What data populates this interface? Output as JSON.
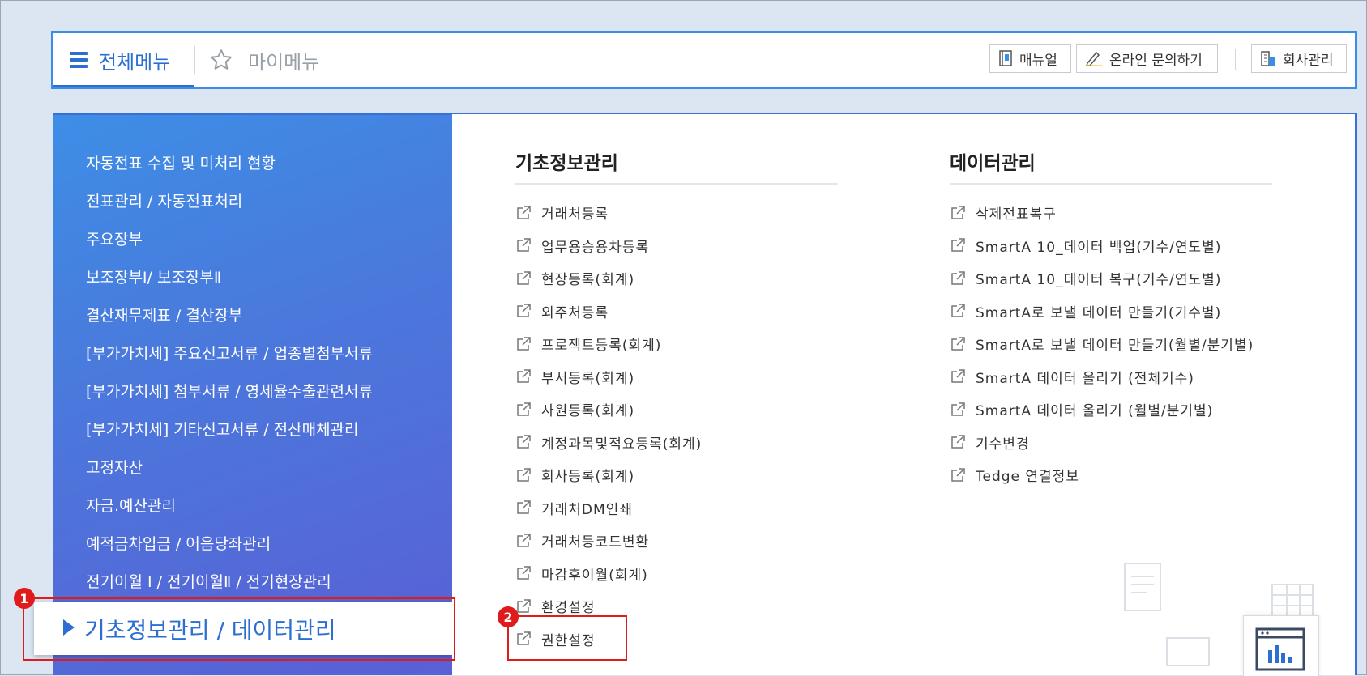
{
  "topbar": {
    "tab_all": "전체메뉴",
    "tab_my": "마이메뉴",
    "btn_manual": "매뉴얼",
    "btn_online": "온라인 문의하기",
    "btn_company": "회사관리"
  },
  "left_menu": {
    "items": [
      "자동전표 수집 및 미처리 현황",
      "전표관리 / 자동전표처리",
      "주요장부",
      "보조장부Ⅰ/ 보조장부Ⅱ",
      "결산재무제표 / 결산장부",
      "[부가가치세] 주요신고서류 / 업종별첨부서류",
      "[부가가치세] 첨부서류 / 영세율수출관련서류",
      "[부가가치세] 기타신고서류 / 전산매체관리",
      "고정자산",
      "자금.예산관리",
      "예적금차입금 / 어음당좌관리",
      "전기이월 Ⅰ / 전기이월Ⅱ / 전기현장관리"
    ],
    "selected": "기초정보관리 / 데이터관리"
  },
  "col1": {
    "title": "기초정보관리",
    "items": [
      "거래처등록",
      "업무용승용차등록",
      "현장등록(회계)",
      "외주처등록",
      "프로젝트등록(회계)",
      "부서등록(회계)",
      "사원등록(회계)",
      "계정과목및적요등록(회계)",
      "회사등록(회계)",
      "거래처DM인쇄",
      "거래처등코드변환",
      "마감후이월(회계)",
      "환경설정",
      "권한설정"
    ]
  },
  "col2": {
    "title": "데이터관리",
    "items": [
      "삭제전표복구",
      "SmartA 10_데이터 백업(기수/연도별)",
      "SmartA 10_데이터 복구(기수/연도별)",
      "SmartA로 보낼 데이터 만들기(기수별)",
      "SmartA로 보낼 데이터 만들기(월별/분기별)",
      "SmartA 데이터 올리기 (전체기수)",
      "SmartA 데이터 올리기 (월별/분기별)",
      "기수변경",
      "Tedge 연결정보"
    ]
  },
  "annotations": {
    "badge1": "1",
    "badge2": "2"
  },
  "colors": {
    "accent": "#2d6fd1",
    "highlight": "#e01b1b"
  }
}
